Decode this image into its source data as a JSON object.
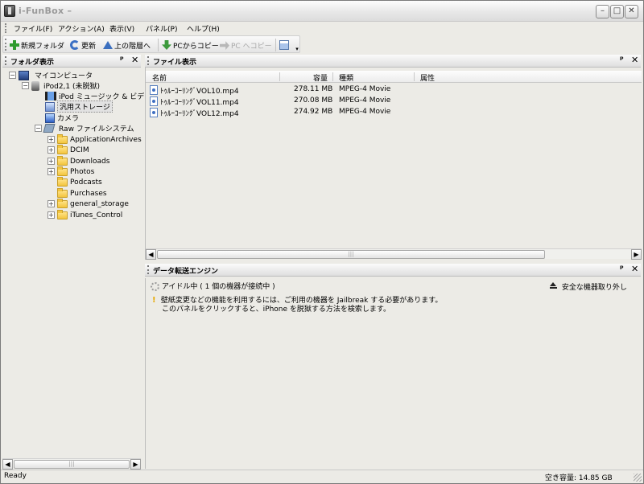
{
  "window": {
    "title": "i-FunBox –"
  },
  "menu": [
    "ファイル(F)",
    "アクション(A)",
    "表示(V)",
    "パネル(P)",
    "ヘルプ(H)"
  ],
  "toolbar": {
    "new_folder": "新規フォルダ",
    "refresh": "更新",
    "up": "上の階層へ",
    "copy_from_pc": "PCからコピー",
    "copy_to_pc": "PC へコピー"
  },
  "folder_panel": {
    "title": "フォルダ表示",
    "tree": {
      "my_computer": "マイコンピュータ",
      "ipod": "iPod2,1 (未脱獄)",
      "ipod_music_video": "iPod ミュージック & ビデオ",
      "storage": "汎用ストレージ",
      "camera": "カメラ",
      "raw_fs": "Raw ファイルシステム",
      "folders": [
        "ApplicationArchives",
        "DCIM",
        "Downloads",
        "Photos",
        "Podcasts",
        "Purchases",
        "general_storage",
        "iTunes_Control"
      ]
    }
  },
  "file_panel": {
    "title": "ファイル表示",
    "columns": [
      "名前",
      "容量",
      "種類",
      "属性"
    ],
    "rows": [
      {
        "name": "ﾄｩﾙｰｺｰﾘﾝｸﾞVOL10.mp4",
        "size": "278.11 MB",
        "type": "MPEG-4 Movie"
      },
      {
        "name": "ﾄｩﾙｰｺｰﾘﾝｸﾞVOL11.mp4",
        "size": "270.08 MB",
        "type": "MPEG-4 Movie"
      },
      {
        "name": "ﾄｩﾙｰｺｰﾘﾝｸﾞVOL12.mp4",
        "size": "274.92 MB",
        "type": "MPEG-4 Movie"
      }
    ]
  },
  "transfer_panel": {
    "title": "データ転送エンジン",
    "status": "アイドル中 ( 1 個の機器が接続中 )",
    "safe_remove": "安全な機器取り外し",
    "warning_line1": "壁紙変更などの機能を利用するには、ご利用の機器を Jailbreak する必要があります。",
    "warning_line2": "このパネルをクリックすると、iPhone を脱獄する方法を検索します。"
  },
  "status": {
    "left": "Ready",
    "free_space": "空き容量: 14.85 GB"
  },
  "icons": {
    "pin": "ᵖ",
    "close": "✕",
    "expand": "+",
    "collapse": "−",
    "scroll_left": "◀",
    "scroll_right": "▶",
    "thumb_grip": "|||"
  }
}
